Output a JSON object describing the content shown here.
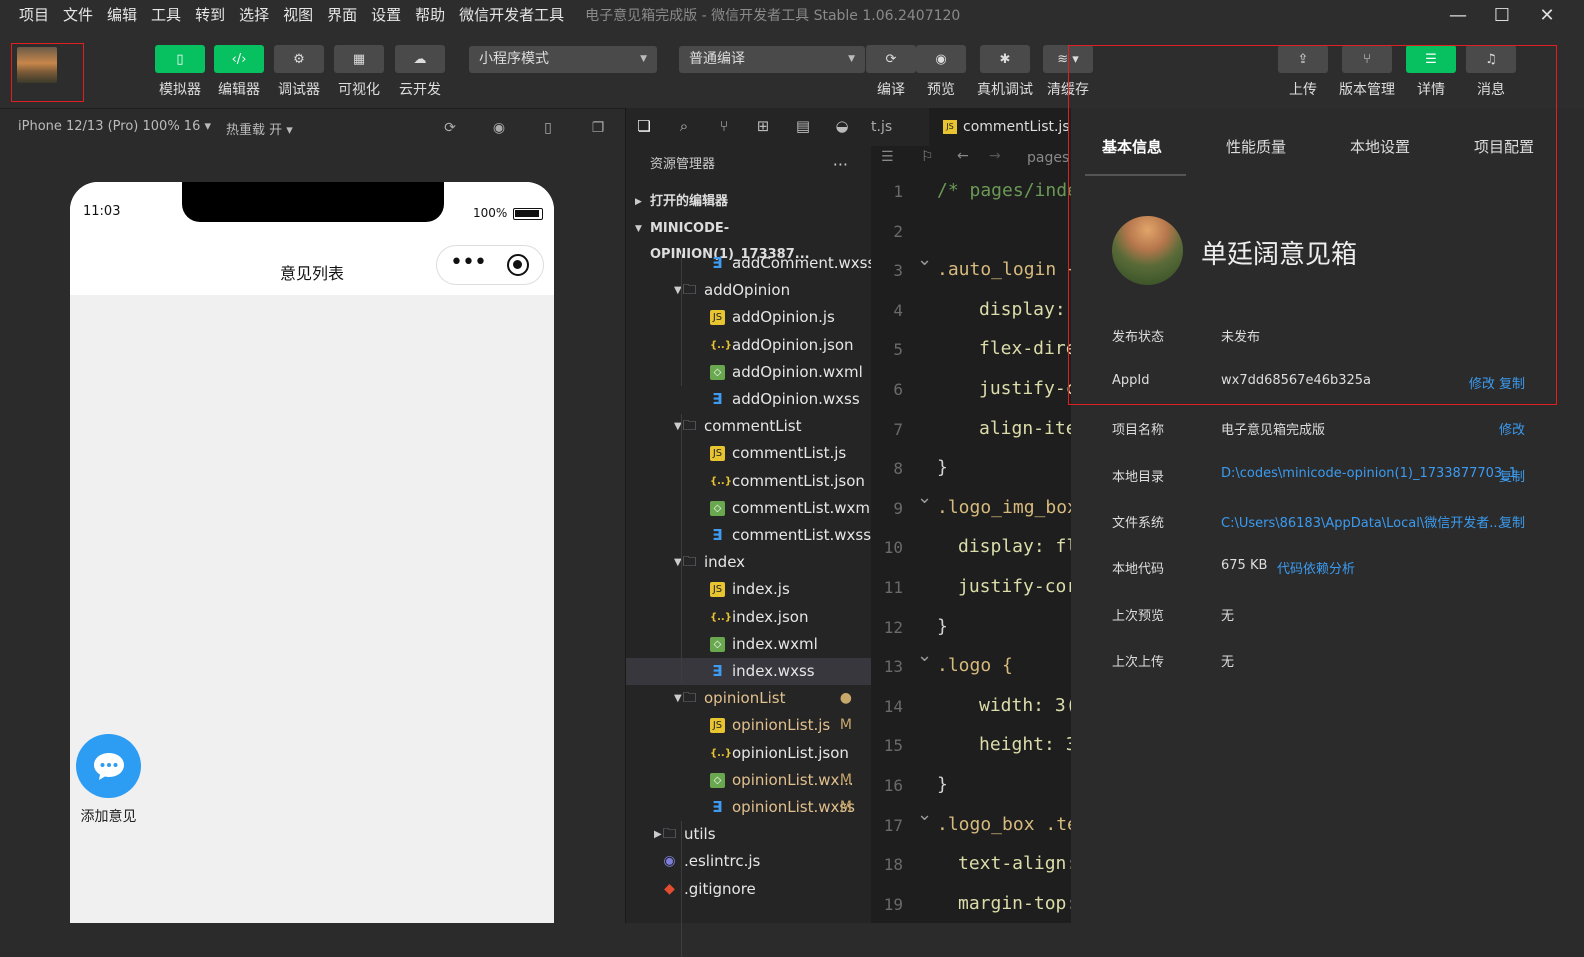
{
  "menubar": {
    "items": [
      "项目",
      "文件",
      "编辑",
      "工具",
      "转到",
      "选择",
      "视图",
      "界面",
      "设置",
      "帮助",
      "微信开发者工具"
    ],
    "window_title": "电子意见箱完成版 - 微信开发者工具 Stable 1.06.2407120"
  },
  "toolbar": {
    "left_buttons": [
      {
        "label": "模拟器",
        "icon": "phone-icon",
        "active": true
      },
      {
        "label": "编辑器",
        "icon": "code-icon",
        "active": true
      },
      {
        "label": "调试器",
        "icon": "debug-icon",
        "active": false
      },
      {
        "label": "可视化",
        "icon": "layout-icon",
        "active": false
      },
      {
        "label": "云开发",
        "icon": "cloud-icon",
        "active": false
      }
    ],
    "mode_select": "小程序模式",
    "compile_select": "普通编译",
    "mid_buttons": [
      {
        "label": "编译",
        "icon": "refresh-icon"
      },
      {
        "label": "预览",
        "icon": "eye-icon"
      },
      {
        "label": "真机调试",
        "icon": "bug-icon"
      },
      {
        "label": "清缓存",
        "icon": "layers-icon"
      }
    ],
    "right_buttons": [
      {
        "label": "上传",
        "icon": "upload-icon",
        "active": false
      },
      {
        "label": "版本管理",
        "icon": "branch-icon",
        "active": false
      },
      {
        "label": "详情",
        "icon": "menu-icon",
        "active": true
      },
      {
        "label": "消息",
        "icon": "bell-icon",
        "active": false
      }
    ]
  },
  "simulator": {
    "device": "iPhone 12/13 (Pro) 100% 16 ▾",
    "hot_reload": "热重载 开 ▾",
    "status_time": "11:03",
    "battery": "100%",
    "page_title": "意见列表",
    "fab_label": "添加意见"
  },
  "explorer": {
    "header": "资源管理器",
    "open_editors": "打开的编辑器",
    "project_root": "MINICODE-OPINION(1)_173387...",
    "files": [
      {
        "name": "addComment.wxss",
        "type": "wxss",
        "indent": 2
      },
      {
        "name": "addOpinion",
        "type": "folder",
        "indent": 1
      },
      {
        "name": "addOpinion.js",
        "type": "js",
        "indent": 2
      },
      {
        "name": "addOpinion.json",
        "type": "json",
        "indent": 2
      },
      {
        "name": "addOpinion.wxml",
        "type": "wxml",
        "indent": 2
      },
      {
        "name": "addOpinion.wxss",
        "type": "wxss",
        "indent": 2
      },
      {
        "name": "commentList",
        "type": "folder",
        "indent": 1
      },
      {
        "name": "commentList.js",
        "type": "js",
        "indent": 2
      },
      {
        "name": "commentList.json",
        "type": "json",
        "indent": 2
      },
      {
        "name": "commentList.wxml",
        "type": "wxml",
        "indent": 2
      },
      {
        "name": "commentList.wxss",
        "type": "wxss",
        "indent": 2
      },
      {
        "name": "index",
        "type": "folder",
        "indent": 1
      },
      {
        "name": "index.js",
        "type": "js",
        "indent": 2
      },
      {
        "name": "index.json",
        "type": "json",
        "indent": 2
      },
      {
        "name": "index.wxml",
        "type": "wxml",
        "indent": 2
      },
      {
        "name": "index.wxss",
        "type": "wxss",
        "indent": 2,
        "selected": true
      },
      {
        "name": "opinionList",
        "type": "folder",
        "indent": 1,
        "badge": "●",
        "modified": true
      },
      {
        "name": "opinionList.js",
        "type": "js",
        "indent": 2,
        "badge": "M",
        "modified": true
      },
      {
        "name": "opinionList.json",
        "type": "json",
        "indent": 2
      },
      {
        "name": "opinionList.wx...",
        "type": "wxml",
        "indent": 2,
        "badge": "M",
        "modified": true
      },
      {
        "name": "opinionList.wxss",
        "type": "wxss",
        "indent": 2,
        "badge": "M",
        "modified": true
      },
      {
        "name": "utils",
        "type": "folder",
        "indent": 0,
        "collapsed": true
      },
      {
        "name": ".eslintrc.js",
        "type": "eslint",
        "indent": 0
      },
      {
        "name": ".gitignore",
        "type": "git",
        "indent": 0
      }
    ]
  },
  "editor": {
    "tab1": "t.js",
    "tab2": "commentList.js",
    "breadcrumb": "pages",
    "lines": [
      {
        "n": "1",
        "text": "/* pages/inde",
        "kind": "comment",
        "indent": 0
      },
      {
        "n": "2",
        "text": "",
        "kind": "plain",
        "indent": 0
      },
      {
        "n": "3",
        "text": ".auto_login {",
        "kind": "selector",
        "indent": 0,
        "fold": true
      },
      {
        "n": "4",
        "text": "display:",
        "kind": "prop",
        "indent": 2
      },
      {
        "n": "5",
        "text": "flex-dire",
        "kind": "prop",
        "indent": 2
      },
      {
        "n": "6",
        "text": "justify-c",
        "kind": "prop",
        "indent": 2
      },
      {
        "n": "7",
        "text": "align-ite",
        "kind": "prop",
        "indent": 2
      },
      {
        "n": "8",
        "text": "}",
        "kind": "plain",
        "indent": 0
      },
      {
        "n": "9",
        "text": ".logo_img_box",
        "kind": "selector",
        "indent": 0,
        "fold": true
      },
      {
        "n": "10",
        "text": "display: fl",
        "kind": "prop",
        "indent": 1
      },
      {
        "n": "11",
        "text": "justify-cor",
        "kind": "prop",
        "indent": 1
      },
      {
        "n": "12",
        "text": "}",
        "kind": "plain",
        "indent": 0
      },
      {
        "n": "13",
        "text": ".logo {",
        "kind": "selector",
        "indent": 0,
        "fold": true
      },
      {
        "n": "14",
        "text": "width: 3(",
        "kind": "prop",
        "indent": 2
      },
      {
        "n": "15",
        "text": "height: 3",
        "kind": "prop",
        "indent": 2
      },
      {
        "n": "16",
        "text": "}",
        "kind": "plain",
        "indent": 0
      },
      {
        "n": "17",
        "text": ".logo_box .te",
        "kind": "selector",
        "indent": 0,
        "fold": true
      },
      {
        "n": "18",
        "text": "text-align:",
        "kind": "prop",
        "indent": 1
      },
      {
        "n": "19",
        "text": "margin-top:",
        "kind": "prop",
        "indent": 1
      }
    ]
  },
  "details": {
    "tabs": [
      "基本信息",
      "性能质量",
      "本地设置",
      "项目配置"
    ],
    "project_name": "单廷阔意见箱",
    "rows": [
      {
        "label": "发布状态",
        "value": "未发布",
        "link": false,
        "actions": ""
      },
      {
        "label": "AppId",
        "value": "wx7dd68567e46b325a",
        "link": false,
        "actions": "修改 复制"
      },
      {
        "label": "项目名称",
        "value": "电子意见箱完成版",
        "link": false,
        "actions": "修改"
      },
      {
        "label": "本地目录",
        "value": "D:\\codes\\minicode-opinion(1)_1733877703_1",
        "link": true,
        "actions": "复制"
      },
      {
        "label": "文件系统",
        "value": "C:\\Users\\86183\\AppData\\Local\\微信开发者...",
        "link": true,
        "actions": "复制"
      },
      {
        "label": "本地代码",
        "value": "675 KB",
        "link": false,
        "actions": "",
        "extra": "代码依赖分析"
      },
      {
        "label": "上次预览",
        "value": "无",
        "link": false,
        "actions": ""
      },
      {
        "label": "上次上传",
        "value": "无",
        "link": false,
        "actions": ""
      }
    ]
  },
  "colors": {
    "accent": "#07c160",
    "link": "#3b9bf0",
    "highlight": "#e02020"
  }
}
